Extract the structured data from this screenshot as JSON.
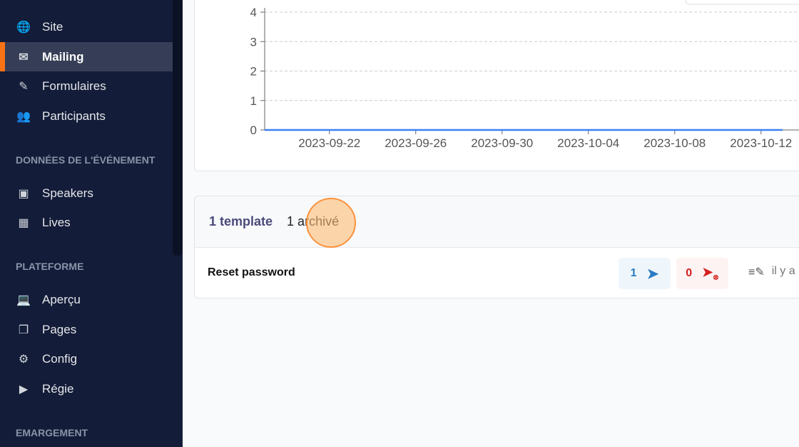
{
  "sidebar": {
    "items": [
      {
        "label": "Site",
        "icon": "globe-icon",
        "glyph": "🌐",
        "active": false
      },
      {
        "label": "Mailing",
        "icon": "mail-icon",
        "glyph": "✉",
        "active": true
      },
      {
        "label": "Formulaires",
        "icon": "pencil-icon",
        "glyph": "✎",
        "active": false
      },
      {
        "label": "Participants",
        "icon": "people-icon",
        "glyph": "👥",
        "active": false
      },
      {
        "label": "Speakers",
        "icon": "badge-icon",
        "glyph": "▣",
        "active": false
      },
      {
        "label": "Lives",
        "icon": "calendar-icon",
        "glyph": "▦",
        "active": false
      },
      {
        "label": "Aperçu",
        "icon": "laptop-icon",
        "glyph": "💻",
        "active": false
      },
      {
        "label": "Pages",
        "icon": "pages-icon",
        "glyph": "❐",
        "active": false
      },
      {
        "label": "Config",
        "icon": "config-icon",
        "glyph": "⚙",
        "active": false
      },
      {
        "label": "Régie",
        "icon": "regie-icon",
        "glyph": "▶",
        "active": false
      }
    ],
    "sections": [
      "DONNÉES DE L'ÉVÉNEMENT",
      "PLATEFORME",
      "EMARGEMENT"
    ],
    "accent": "#f97316"
  },
  "chart_data": {
    "type": "line",
    "x_ticks": [
      "2023-09-22",
      "2023-09-26",
      "2023-09-30",
      "2023-10-04",
      "2023-10-08",
      "2023-10-12"
    ],
    "y_ticks": [
      0,
      1,
      2,
      3,
      4
    ],
    "xlim": [
      "2023-09-19",
      "2023-10-13"
    ],
    "ylim": [
      0,
      4
    ],
    "grid": true,
    "series": [
      {
        "x": [
          "2023-09-19",
          "2023-10-13"
        ],
        "values": [
          0,
          0
        ],
        "color": "#3b82f6"
      }
    ]
  },
  "list": {
    "tabs": [
      {
        "label": "1 template",
        "active": true
      },
      {
        "label": "1 archivé",
        "active": false
      }
    ],
    "rows": [
      {
        "name": "Reset password",
        "sent": "1",
        "failed": "0",
        "date": "il y a"
      }
    ]
  }
}
